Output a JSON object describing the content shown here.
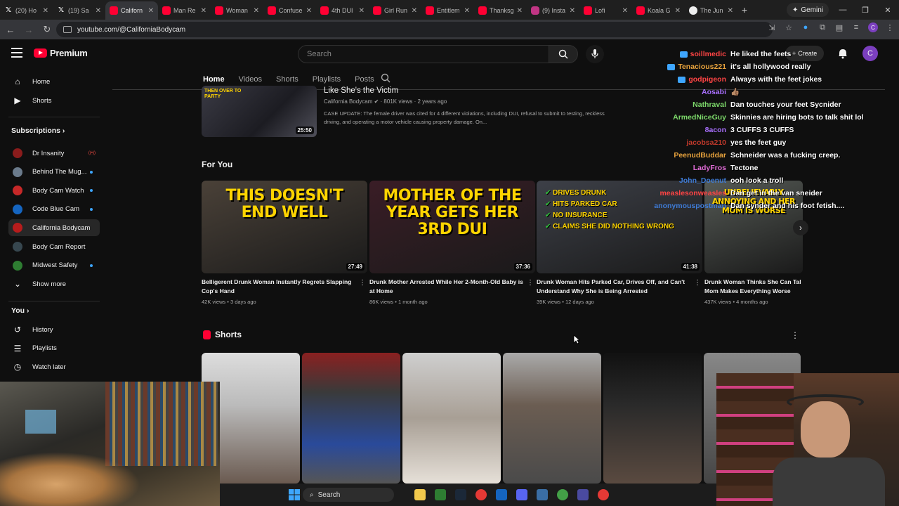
{
  "browser": {
    "tabs": [
      {
        "label": "(20) Ho",
        "icon": "x-icon"
      },
      {
        "label": "(19) Sa",
        "icon": "x-icon"
      },
      {
        "label": "Californ",
        "icon": "youtube-icon",
        "active": true
      },
      {
        "label": "Man Re",
        "icon": "youtube-icon"
      },
      {
        "label": "Woman",
        "icon": "youtube-icon"
      },
      {
        "label": "Confuse",
        "icon": "youtube-icon"
      },
      {
        "label": "4th DUI",
        "icon": "youtube-icon"
      },
      {
        "label": "Girl Run",
        "icon": "youtube-icon"
      },
      {
        "label": "Entitlem",
        "icon": "youtube-icon"
      },
      {
        "label": "Thanksg",
        "icon": "youtube-icon"
      },
      {
        "label": "(9) Insta",
        "icon": "instagram-icon"
      },
      {
        "label": "Lofi",
        "icon": "youtube-icon"
      },
      {
        "label": "Koala G",
        "icon": "youtube-icon"
      },
      {
        "label": "The Jun",
        "icon": "globe-icon"
      }
    ],
    "gemini_label": "Gemini",
    "url": "youtube.com/@CaliforniaBodycam"
  },
  "youtube": {
    "logo_text": "Premium",
    "search_placeholder": "Search",
    "create_label": "Create",
    "account_initial": "C",
    "sidebar": {
      "main": [
        {
          "label": "Home",
          "icon": "home-icon"
        },
        {
          "label": "Shorts",
          "icon": "shorts-icon"
        }
      ],
      "subscriptions_header": "Subscriptions",
      "subscriptions": [
        {
          "label": "Dr Insanity",
          "color": "#8a1c1c",
          "status": "live"
        },
        {
          "label": "Behind The Mug...",
          "color": "#6b7b8c",
          "status": "dot"
        },
        {
          "label": "Body Cam Watch",
          "color": "#c62828",
          "status": "dot"
        },
        {
          "label": "Code Blue Cam",
          "color": "#1565c0",
          "status": "dot"
        },
        {
          "label": "California Bodycam",
          "color": "#b71c1c",
          "status": "none",
          "active": true
        },
        {
          "label": "Body Cam Report",
          "color": "#37474f",
          "status": "none"
        },
        {
          "label": "Midwest Safety",
          "color": "#2e7d32",
          "status": "dot"
        }
      ],
      "show_more": "Show more",
      "you_header": "You",
      "you_items": [
        {
          "label": "History",
          "icon": "history-icon"
        },
        {
          "label": "Playlists",
          "icon": "playlists-icon"
        },
        {
          "label": "Watch later",
          "icon": "clock-icon"
        }
      ]
    },
    "channel_tabs": [
      "Home",
      "Videos",
      "Shorts",
      "Playlists",
      "Posts"
    ],
    "featured": {
      "overlay_text": "THEN OVER TO PARTY",
      "title": "Like She's the Victim",
      "channel": "California Bodycam",
      "views": "801K views",
      "age": "2 years ago",
      "duration": "25:50",
      "description": "CASE UPDATE: The female driver was cited for 4 different violations, including DUI, refusal to submit to testing, reckless driving, and operating a motor vehicle causing property damage. On..."
    },
    "for_you_title": "For You",
    "for_you": [
      {
        "thumb_text": "THIS DOESN'T END WELL",
        "duration": "27:49",
        "title": "Belligerent Drunk Woman Instantly Regrets Slapping Cop's Hand",
        "views": "42K views",
        "age": "3 days ago",
        "bg": "#4a4138"
      },
      {
        "thumb_text": "MOTHER OF THE YEAR GETS HER 3RD DUI",
        "duration": "37:36",
        "title": "Drunk Mother Arrested While Her 2-Month-Old Baby is at Home",
        "views": "86K views",
        "age": "1 month ago",
        "bg": "#3a1d26"
      },
      {
        "checks": [
          "DRIVES DRUNK",
          "HITS PARKED CAR",
          "NO INSURANCE",
          "CLAIMS SHE DID NOTHING WRONG"
        ],
        "duration": "41:38",
        "title": "Drunk Woman Hits Parked Car, Drives Off, and Can't Understand Why She is Being Arrested",
        "views": "39K views",
        "age": "12 days ago",
        "bg": "#3d4048"
      },
      {
        "thumb_text": "UNBELIEVABLY ANNOYING AND HER MOM IS WORSE",
        "duration": "",
        "title": "Drunk Woman Thinks She Can Tal Mom Makes Everything Worse",
        "views": "437K views",
        "age": "4 months ago",
        "bg": "#555a55"
      }
    ],
    "shorts_title": "Shorts"
  },
  "chat": [
    {
      "user": "soillmedic",
      "color": "#ff4444",
      "badge": true,
      "msg": "He liked the feets"
    },
    {
      "user": "Tenacious221",
      "color": "#e8a33d",
      "badge": true,
      "msg": "it's all hollywood really"
    },
    {
      "user": "godpigeon",
      "color": "#ff4444",
      "badge": true,
      "msg": "Always with the feet jokes"
    },
    {
      "user": "Aosabi",
      "color": "#a970ff",
      "badge": false,
      "msg": "👍🏽"
    },
    {
      "user": "Nathraval",
      "color": "#7cd86a",
      "badge": false,
      "msg": "Dan touches your feet Sycnider"
    },
    {
      "user": "ArmedNiceGuy",
      "color": "#7cd86a",
      "badge": false,
      "msg": "Skinnies are hiring bots to talk shit lol"
    },
    {
      "user": "8acon",
      "color": "#a970ff",
      "badge": false,
      "msg": "3 CUFFS 3 CUFFS"
    },
    {
      "user": "jacobsa210",
      "color": "#c0392b",
      "badge": false,
      "msg": "yes the feet guy"
    },
    {
      "user": "PeenudBuddar",
      "color": "#e8a33d",
      "badge": false,
      "msg": "Schneider was a fucking creep."
    },
    {
      "user": "LadyFros",
      "color": "#e06bd6",
      "badge": false,
      "msg": "Tectone"
    },
    {
      "user": "John_Doenut",
      "color": "#3e7bd6",
      "badge": false,
      "msg": "ooh look a troll"
    },
    {
      "user": "measlesonweasles",
      "color": "#ff4444",
      "badge": false,
      "msg": "Dan get in the van sneider"
    },
    {
      "user": "anonymouspostman",
      "color": "#3e7bd6",
      "badge": false,
      "msg": "Dan synder and his foot fetish...."
    }
  ],
  "taskbar": {
    "search_label": "Search"
  }
}
